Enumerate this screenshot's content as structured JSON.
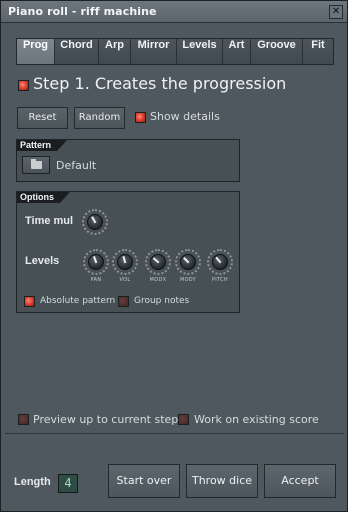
{
  "window": {
    "title": "Piano roll - riff machine",
    "close_icon": "close-icon"
  },
  "tabs": [
    {
      "label": "Prog",
      "active": true
    },
    {
      "label": "Chord",
      "active": false
    },
    {
      "label": "Arp",
      "active": false
    },
    {
      "label": "Mirror",
      "active": false
    },
    {
      "label": "Levels",
      "active": false
    },
    {
      "label": "Art",
      "active": false
    },
    {
      "label": "Groove",
      "active": false
    },
    {
      "label": "Fit",
      "active": false
    }
  ],
  "step": {
    "title": "Step 1. Creates the progression",
    "checked": true
  },
  "controls": {
    "reset_label": "Reset",
    "random_label": "Random",
    "show_details_label": "Show details",
    "show_details_checked": true
  },
  "pattern": {
    "header": "Pattern",
    "value": "Default",
    "folder_icon": "folder-icon"
  },
  "options": {
    "header": "Options",
    "time_mul_label": "Time mul",
    "levels_label": "Levels",
    "level_knobs": [
      {
        "label": "PAN"
      },
      {
        "label": "VOL"
      },
      {
        "label": "MODX"
      },
      {
        "label": "MODY"
      },
      {
        "label": "PITCH"
      }
    ],
    "absolute_pattern_label": "Absolute pattern",
    "absolute_pattern_checked": true,
    "group_notes_label": "Group notes",
    "group_notes_checked": false
  },
  "preview": {
    "preview_label": "Preview up to current step",
    "preview_checked": false,
    "work_existing_label": "Work on existing score",
    "work_existing_checked": false
  },
  "footer": {
    "length_label": "Length",
    "length_value": "4",
    "start_over_label": "Start over",
    "throw_dice_label": "Throw dice",
    "accept_label": "Accept"
  },
  "colors": {
    "accent_check": "#e24532",
    "background": "#4f585e"
  }
}
